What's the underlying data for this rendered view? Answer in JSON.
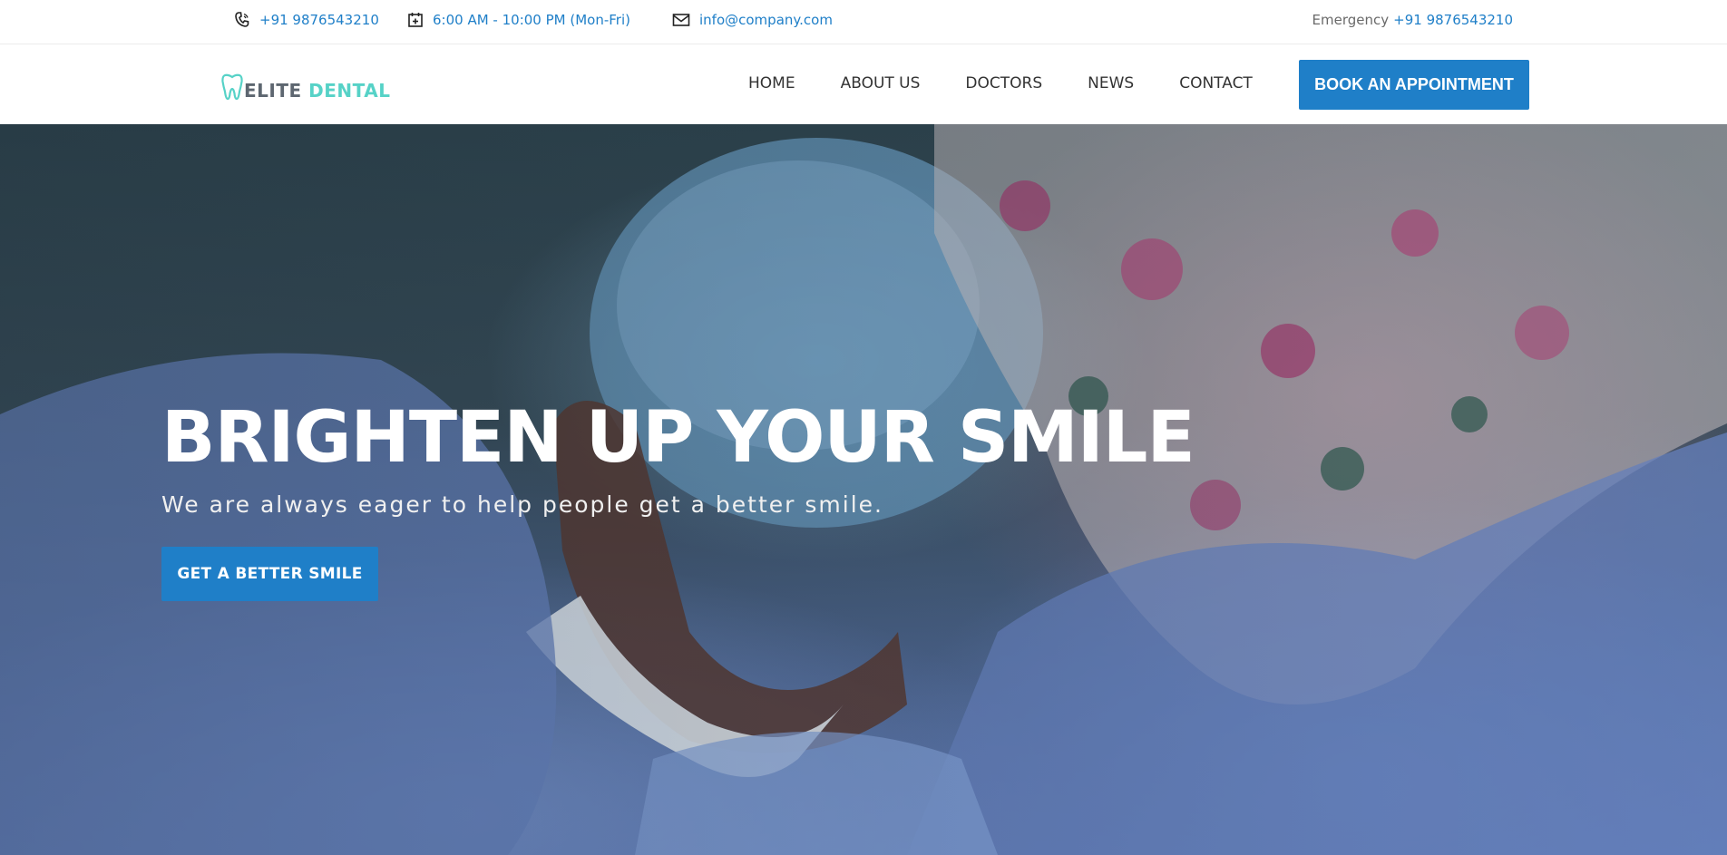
{
  "topbar": {
    "phone": "+91 9876543210",
    "hours": "6:00 AM - 10:00 PM (Mon-Fri)",
    "email": "info@company.com",
    "emergency_label": "Emergency",
    "emergency_phone": "+91 9876543210",
    "icons": [
      "phone-icon",
      "calendar-icon",
      "envelope-icon"
    ]
  },
  "navbar": {
    "logo": {
      "word1": "ELITE",
      "word2": "DENTAL",
      "icon": "tooth-icon"
    },
    "menu": [
      {
        "label": "HOME"
      },
      {
        "label": "ABOUT US"
      },
      {
        "label": "DOCTORS"
      },
      {
        "label": "NEWS"
      },
      {
        "label": "CONTACT"
      }
    ],
    "cta_label": "BOOK AN APPOINTMENT"
  },
  "hero": {
    "title": "BRIGHTEN UP YOUR SMILE",
    "subtitle": "We are always eager to help people get a better smile.",
    "button_label": "GET A BETTER SMILE"
  },
  "colors": {
    "accent": "#1f7fc8",
    "logo_teal": "#56d2c7",
    "logo_gray": "#5d6670"
  }
}
